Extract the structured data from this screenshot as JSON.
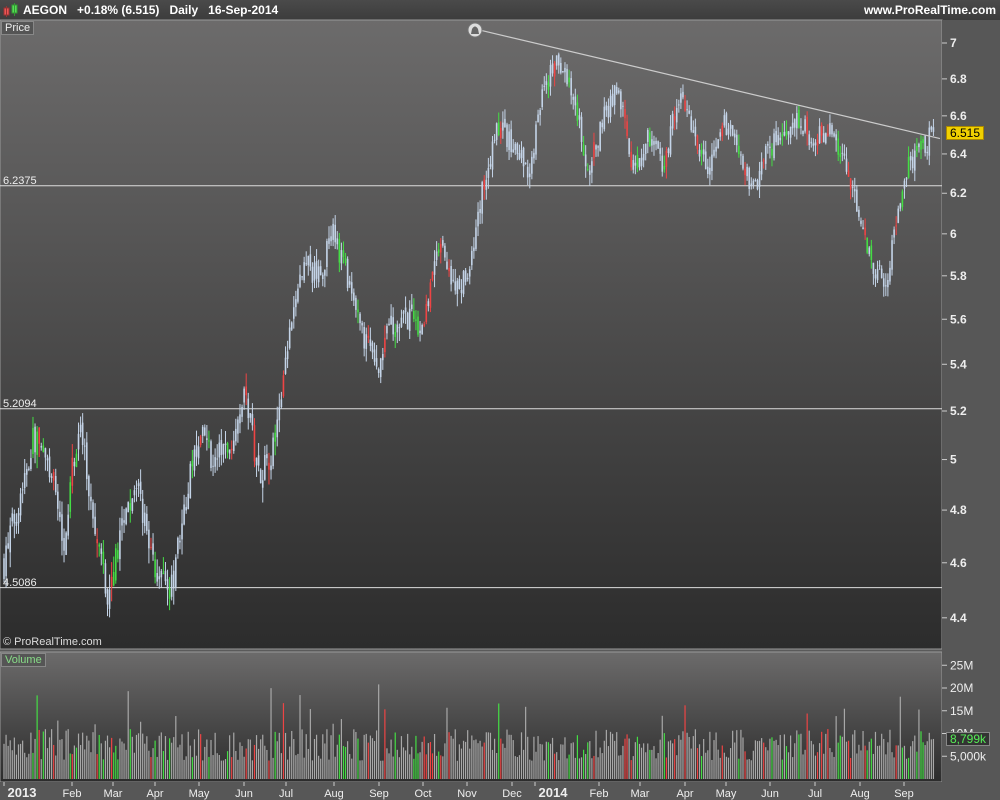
{
  "header": {
    "symbol": "AEGON",
    "change": "+0.18% (6.515)",
    "period": "Daily",
    "date": "16-Sep-2014",
    "site": "www.ProRealTime.com"
  },
  "panels": {
    "price_label": "Price",
    "volume_label": "Volume",
    "copyright": "© ProRealTime.com"
  },
  "colors": {
    "bar": "#c4d4e8",
    "up": "#44dd44",
    "down": "#ee4444",
    "volume": "#a8a8a8"
  },
  "chart_data": [
    {
      "type": "candlestick",
      "title": "AEGON Daily",
      "scale": "log",
      "ylim": [
        4.35,
        7.1
      ],
      "yticks": [
        "4.4",
        "4.6",
        "4.8",
        "5",
        "5.2",
        "5.4",
        "5.6",
        "5.8",
        "6",
        "6.2",
        "6.4",
        "6.6",
        "6.8",
        "7"
      ],
      "xticks": [
        "2013",
        "Feb",
        "Mar",
        "Apr",
        "May",
        "Jun",
        "Jul",
        "Aug",
        "Sep",
        "Oct",
        "Nov",
        "Dec",
        "2014",
        "Feb",
        "Mar",
        "Apr",
        "May",
        "Jun",
        "Jul",
        "Aug",
        "Sep"
      ],
      "approx_closes": [
        4.6,
        4.85,
        5.1,
        4.95,
        4.7,
        5.15,
        4.75,
        4.45,
        4.8,
        4.85,
        4.6,
        4.45,
        4.8,
        5.1,
        5.0,
        5.05,
        5.3,
        4.95,
        5.05,
        5.5,
        5.85,
        5.8,
        6.0,
        5.75,
        5.5,
        5.4,
        5.6,
        5.6,
        5.55,
        5.95,
        5.75,
        5.8,
        6.25,
        6.55,
        6.45,
        6.3,
        6.75,
        6.9,
        6.7,
        6.3,
        6.6,
        6.75,
        6.3,
        6.5,
        6.35,
        6.7,
        6.5,
        6.3,
        6.55,
        6.45,
        6.2,
        6.45,
        6.45,
        6.6,
        6.45,
        6.55,
        6.35,
        6.1,
        5.8,
        5.8,
        6.3,
        6.4,
        6.515
      ],
      "last_price": "6.515",
      "horizontal_levels": [
        "6.2375",
        "5.2094",
        "4.5086"
      ],
      "trendline": {
        "from_price": 7.08,
        "to_price": 6.48
      }
    },
    {
      "type": "bar",
      "title": "Volume",
      "yticks": [
        "5,000k",
        "10M",
        "15M",
        "20M",
        "25M"
      ],
      "ylim": [
        0,
        27
      ],
      "last_value": "8,799k"
    }
  ]
}
